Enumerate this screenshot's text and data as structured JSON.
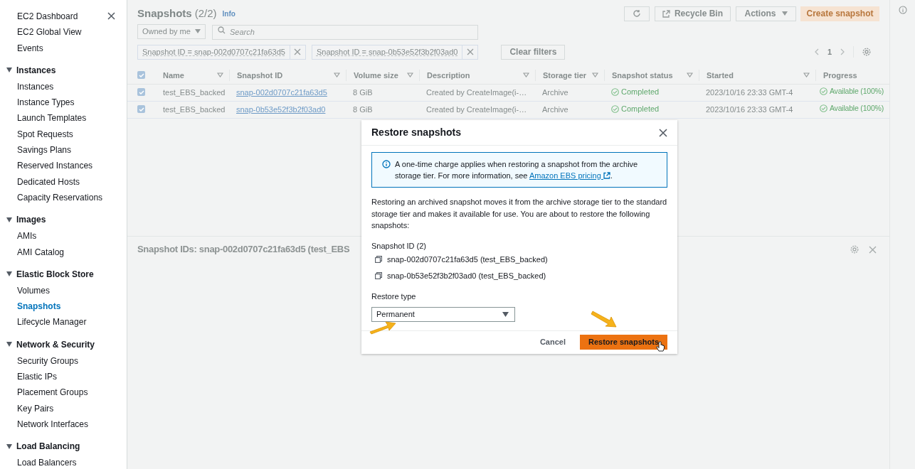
{
  "sidebar": {
    "top_items": [
      {
        "label": "EC2 Dashboard",
        "selected": false
      },
      {
        "label": "EC2 Global View",
        "selected": false
      },
      {
        "label": "Events",
        "selected": false
      }
    ],
    "sections": [
      {
        "title": "Instances",
        "expanded": true,
        "items": [
          {
            "label": "Instances",
            "selected": false
          },
          {
            "label": "Instance Types",
            "selected": false
          },
          {
            "label": "Launch Templates",
            "selected": false
          },
          {
            "label": "Spot Requests",
            "selected": false
          },
          {
            "label": "Savings Plans",
            "selected": false
          },
          {
            "label": "Reserved Instances",
            "selected": false
          },
          {
            "label": "Dedicated Hosts",
            "selected": false
          },
          {
            "label": "Capacity Reservations",
            "selected": false
          }
        ]
      },
      {
        "title": "Images",
        "expanded": true,
        "items": [
          {
            "label": "AMIs",
            "selected": false
          },
          {
            "label": "AMI Catalog",
            "selected": false
          }
        ]
      },
      {
        "title": "Elastic Block Store",
        "expanded": true,
        "items": [
          {
            "label": "Volumes",
            "selected": false
          },
          {
            "label": "Snapshots",
            "selected": true
          },
          {
            "label": "Lifecycle Manager",
            "selected": false
          }
        ]
      },
      {
        "title": "Network & Security",
        "expanded": true,
        "items": [
          {
            "label": "Security Groups",
            "selected": false
          },
          {
            "label": "Elastic IPs",
            "selected": false
          },
          {
            "label": "Placement Groups",
            "selected": false
          },
          {
            "label": "Key Pairs",
            "selected": false
          },
          {
            "label": "Network Interfaces",
            "selected": false
          }
        ]
      },
      {
        "title": "Load Balancing",
        "expanded": true,
        "items": [
          {
            "label": "Load Balancers",
            "selected": false
          }
        ]
      }
    ]
  },
  "header": {
    "title": "Snapshots",
    "count": "(2/2)",
    "info": "Info",
    "buttons": [
      "Recycle Bin",
      "Actions",
      "Create snapshot"
    ]
  },
  "filter_bar": {
    "owner_dropdown": "Owned by me",
    "search_placeholder": "Search",
    "tokens": [
      "Snapshot ID = snap-002d0707c21fa63d5",
      "Snapshot ID = snap-0b53e52f3b2f03ad0"
    ],
    "clear_button": "Clear filters",
    "page": "1"
  },
  "table": {
    "all_checked": true,
    "columns": [
      "Name",
      "Snapshot ID",
      "Volume size",
      "Description",
      "Storage tier",
      "Snapshot status",
      "Started",
      "Progress"
    ],
    "rows": [
      {
        "checked": true,
        "cells": [
          "test_EBS_backed",
          "snap-002d0707c21fa63d5",
          "8 GiB",
          "Created by CreateImage(i-…",
          "Archive",
          "Completed",
          "2023/10/16 23:33 GMT-4",
          "Available (100%)"
        ]
      },
      {
        "checked": true,
        "cells": [
          "test_EBS_backed",
          "snap-0b53e52f3b2f03ad0",
          "8 GiB",
          "Created by CreateImage(i-…",
          "Archive",
          "Completed",
          "2023/10/16 23:33 GMT-4",
          "Available (100%)"
        ]
      }
    ]
  },
  "split_panel": {
    "title": "Snapshot IDs: snap-002d0707c21fa63d5 (test_EBS"
  },
  "modal": {
    "title": "Restore snapshots",
    "alert": {
      "text": "A one-time charge applies when restoring a snapshot from the archive storage tier. For more information, see ",
      "link": "Amazon EBS pricing",
      "suffix": "."
    },
    "body": "Restoring an archived snapshot moves it from the archive storage tier to the standard storage tier and makes it available for use. You are about to restore the following snapshots:",
    "list_label": "Snapshot ID (2)",
    "snapshots": [
      "snap-002d0707c21fa63d5 (test_EBS_backed)",
      "snap-0b53e52f3b2f03ad0 (test_EBS_backed)"
    ],
    "restore_type_label": "Restore type",
    "restore_type": "Permanent",
    "cancel": "Cancel",
    "confirm": "Restore snapshots"
  }
}
